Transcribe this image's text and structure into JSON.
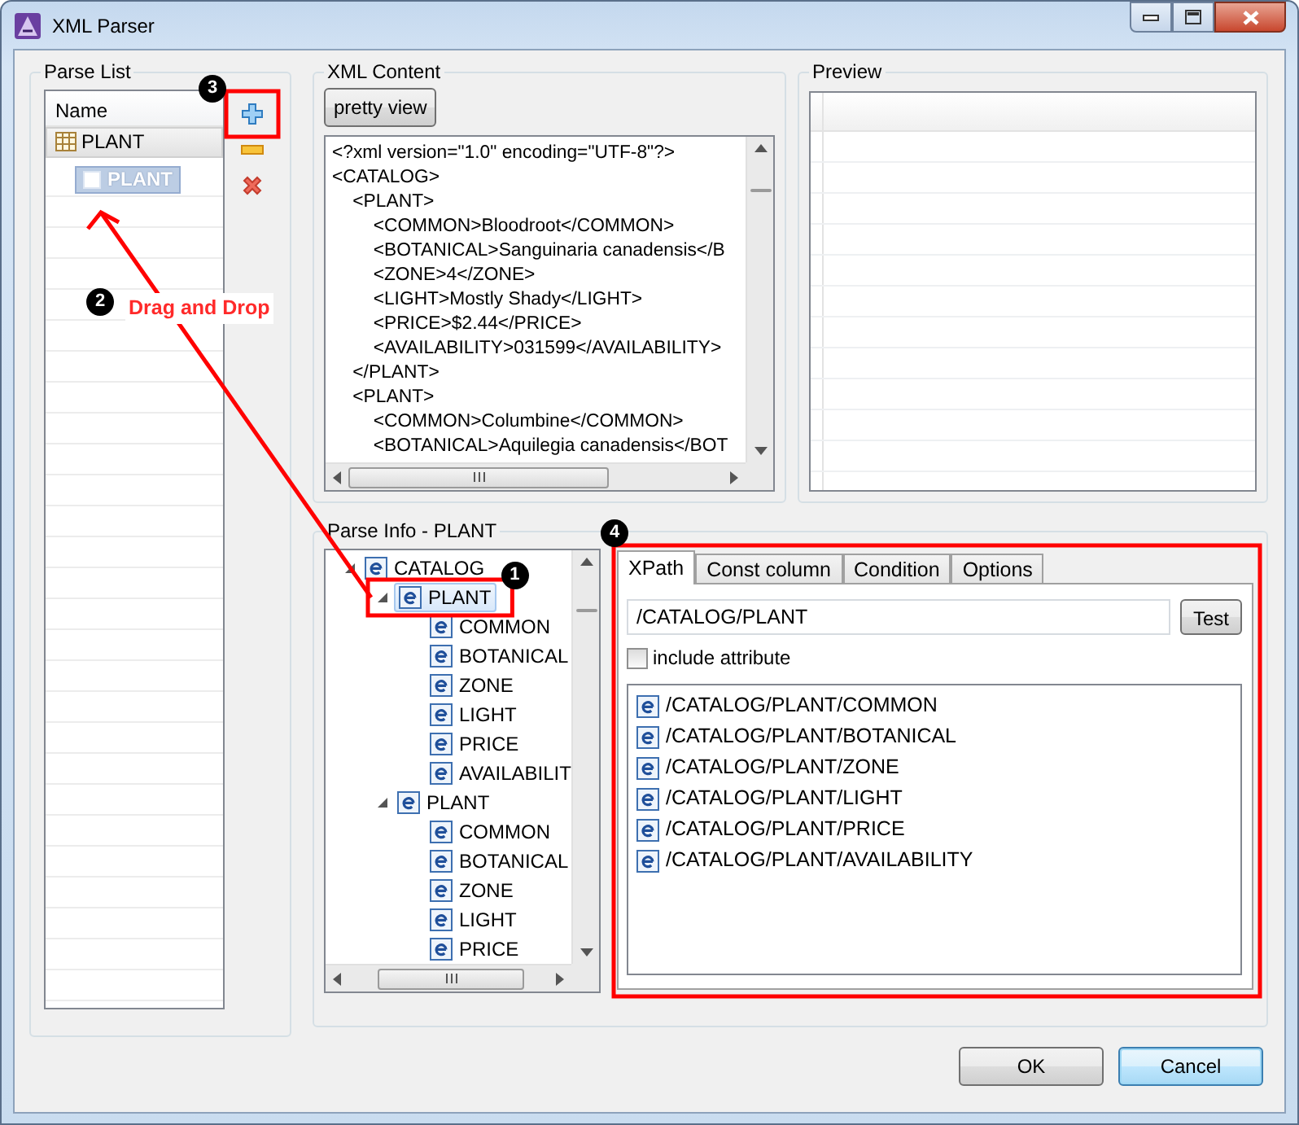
{
  "window": {
    "title": "XML Parser"
  },
  "parse_list": {
    "title": "Parse List",
    "column": "Name",
    "rows": [
      {
        "label": "PLANT",
        "selected": true
      }
    ],
    "drag_ghost": "PLANT"
  },
  "xml_content": {
    "title": "XML Content",
    "button": "pretty view",
    "lines": [
      "<?xml version=\"1.0\" encoding=\"UTF-8\"?>",
      "<CATALOG>",
      "    <PLANT>",
      "        <COMMON>Bloodroot</COMMON>",
      "        <BOTANICAL>Sanguinaria canadensis</B",
      "        <ZONE>4</ZONE>",
      "        <LIGHT>Mostly Shady</LIGHT>",
      "        <PRICE>$2.44</PRICE>",
      "        <AVAILABILITY>031599</AVAILABILITY>",
      "    </PLANT>",
      "    <PLANT>",
      "        <COMMON>Columbine</COMMON>",
      "        <BOTANICAL>Aquilegia canadensis</BOT"
    ]
  },
  "preview": {
    "title": "Preview"
  },
  "parse_info": {
    "title": "Parse Info - PLANT",
    "tree": [
      {
        "label": "CATALOG",
        "expanded": true,
        "selected": false,
        "children": [
          {
            "label": "PLANT",
            "expanded": true,
            "selected": true,
            "children": [
              {
                "label": "COMMON",
                "selected": false
              },
              {
                "label": "BOTANICAL",
                "selected": false
              },
              {
                "label": "ZONE",
                "selected": false
              },
              {
                "label": "LIGHT",
                "selected": false
              },
              {
                "label": "PRICE",
                "selected": false
              },
              {
                "label": "AVAILABILIT",
                "selected": false
              }
            ]
          },
          {
            "label": "PLANT",
            "expanded": true,
            "selected": false,
            "children": [
              {
                "label": "COMMON",
                "selected": false
              },
              {
                "label": "BOTANICAL",
                "selected": false
              },
              {
                "label": "ZONE",
                "selected": false
              },
              {
                "label": "LIGHT",
                "selected": false
              },
              {
                "label": "PRICE",
                "selected": false
              }
            ]
          }
        ]
      }
    ],
    "tabs": [
      {
        "label": "XPath",
        "selected": true
      },
      {
        "label": "Const column",
        "selected": false
      },
      {
        "label": "Condition",
        "selected": false
      },
      {
        "label": "Options",
        "selected": false
      }
    ],
    "xpath": {
      "value": "/CATALOG/PLANT"
    },
    "test_button": "Test",
    "include_attribute": {
      "label": "include attribute",
      "checked": false
    },
    "paths": [
      "/CATALOG/PLANT/COMMON",
      "/CATALOG/PLANT/BOTANICAL",
      "/CATALOG/PLANT/ZONE",
      "/CATALOG/PLANT/LIGHT",
      "/CATALOG/PLANT/PRICE",
      "/CATALOG/PLANT/AVAILABILITY"
    ]
  },
  "buttons": [
    {
      "label": "OK",
      "focused": false
    },
    {
      "label": "Cancel",
      "focused": true
    }
  ],
  "annotations": {
    "badges": [
      "1",
      "2",
      "3",
      "4"
    ],
    "drag_label": "Drag and Drop"
  }
}
